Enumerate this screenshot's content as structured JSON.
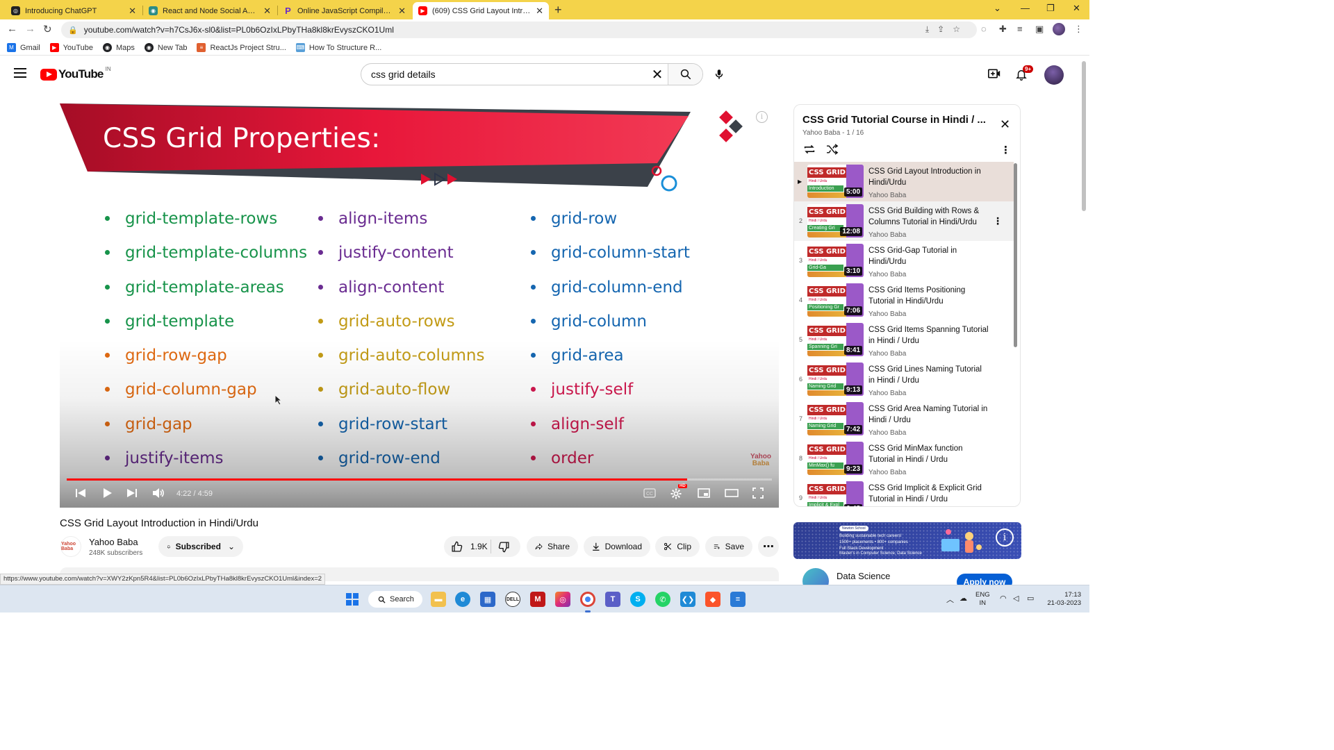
{
  "browser": {
    "tabs": [
      {
        "title": "Introducing ChatGPT",
        "color": "#222"
      },
      {
        "title": "React and Node Social App with ",
        "color": "#2a8c85"
      },
      {
        "title": "Online JavaScript Compiler (Edit",
        "color": "#6a2cc7"
      },
      {
        "title": "(609) CSS Grid Layout Introductio",
        "color": "#ff0000"
      }
    ],
    "url": "youtube.com/watch?v=h7CsJ6x-sl0&list=PL0b6OzIxLPbyTHa8kl8krEvyszCKO1Uml",
    "bookmarks": [
      {
        "label": "Gmail",
        "color": "#1a73e8",
        "glyph": "M"
      },
      {
        "label": "YouTube",
        "color": "#ff0000",
        "glyph": "▶"
      },
      {
        "label": "Maps",
        "color": "#202124",
        "glyph": "◉"
      },
      {
        "label": "New Tab",
        "color": "#202124",
        "glyph": "◉"
      },
      {
        "label": "ReactJs Project Stru...",
        "color": "#e06030",
        "glyph": "≡"
      },
      {
        "label": "How To Structure R...",
        "color": "#5aa0d8",
        "glyph": "⌨"
      }
    ]
  },
  "youtube": {
    "logo_word": "YouTube",
    "country": "IN",
    "search_value": "css grid details",
    "notif_badge": "9+"
  },
  "player": {
    "slide_title": "CSS Grid Properties:",
    "columns": [
      [
        {
          "text": "grid-template-rows",
          "color": "#17934a"
        },
        {
          "text": "grid-template-columns",
          "color": "#17934a"
        },
        {
          "text": "grid-template-areas",
          "color": "#17934a"
        },
        {
          "text": "grid-template",
          "color": "#17934a"
        },
        {
          "text": "grid-row-gap",
          "color": "#e06a12"
        },
        {
          "text": "grid-column-gap",
          "color": "#e06a12"
        },
        {
          "text": "grid-gap",
          "color": "#e06a12"
        },
        {
          "text": "justify-items",
          "color": "#6a2c91"
        }
      ],
      [
        {
          "text": "align-items",
          "color": "#6a2c91"
        },
        {
          "text": "justify-content",
          "color": "#6a2c91"
        },
        {
          "text": "align-content",
          "color": "#6a2c91"
        },
        {
          "text": "grid-auto-rows",
          "color": "#c29b16"
        },
        {
          "text": "grid-auto-columns",
          "color": "#c29b16"
        },
        {
          "text": "grid-auto-flow",
          "color": "#c29b16"
        },
        {
          "text": "grid-row-start",
          "color": "#1566b0"
        },
        {
          "text": "grid-row-end",
          "color": "#1566b0"
        }
      ],
      [
        {
          "text": "grid-row",
          "color": "#1566b0"
        },
        {
          "text": "grid-column-start",
          "color": "#1566b0"
        },
        {
          "text": "grid-column-end",
          "color": "#1566b0"
        },
        {
          "text": "grid-column",
          "color": "#1566b0"
        },
        {
          "text": "grid-area",
          "color": "#1566b0"
        },
        {
          "text": "justify-self",
          "color": "#d2184f"
        },
        {
          "text": "align-self",
          "color": "#d2184f"
        },
        {
          "text": "order",
          "color": "#d2184f"
        }
      ]
    ],
    "watermark_top": "Yahoo",
    "watermark_bottom": "Baba",
    "time": "4:22 / 4:59",
    "progress": 0.88
  },
  "video": {
    "title": "CSS Grid Layout Introduction in Hindi/Urdu",
    "channel_name": "Yahoo Baba",
    "channel_avatar_text": "Yahoo Baba",
    "subscribers": "248K subscribers",
    "subscribe_label": "Subscribed",
    "likes": "1.9K",
    "share_label": "Share",
    "download_label": "Download",
    "clip_label": "Clip",
    "save_label": "Save"
  },
  "playlist": {
    "title": "CSS Grid Tutorial Course in Hindi / ...",
    "subtitle": "Yahoo Baba - 1 / 16",
    "items": [
      {
        "index": "▶",
        "title": "CSS Grid Layout Introduction in Hindi/Urdu",
        "channel": "Yahoo Baba",
        "duration": "5:00",
        "thumb_tag": "Introduction"
      },
      {
        "index": "2",
        "title": "CSS Grid Building with Rows & Columns Tutorial in Hindi/Urdu",
        "channel": "Yahoo Baba",
        "duration": "12:08",
        "thumb_tag": "Creating Gri"
      },
      {
        "index": "3",
        "title": "CSS Grid-Gap Tutorial in Hindi/Urdu",
        "channel": "Yahoo Baba",
        "duration": "3:10",
        "thumb_tag": "Grid-Ga"
      },
      {
        "index": "4",
        "title": "CSS Grid Items Positioning Tutorial in Hindi/Urdu",
        "channel": "Yahoo Baba",
        "duration": "7:06",
        "thumb_tag": "Positioning Gr"
      },
      {
        "index": "5",
        "title": "CSS Grid Items Spanning Tutorial in Hindi / Urdu",
        "channel": "Yahoo Baba",
        "duration": "8:41",
        "thumb_tag": "Spanning Gri"
      },
      {
        "index": "6",
        "title": "CSS Grid Lines Naming Tutorial in Hindi / Urdu",
        "channel": "Yahoo Baba",
        "duration": "9:13",
        "thumb_tag": "Naming Grid"
      },
      {
        "index": "7",
        "title": "CSS Grid Area Naming Tutorial in Hindi / Urdu",
        "channel": "Yahoo Baba",
        "duration": "7:42",
        "thumb_tag": "Naming Grid"
      },
      {
        "index": "8",
        "title": "CSS Grid MinMax function Tutorial in Hindi / Urdu",
        "channel": "Yahoo Baba",
        "duration": "9:23",
        "thumb_tag": "MinMax() fu"
      },
      {
        "index": "9",
        "title": "CSS Grid Implicit & Explicit Grid Tutorial in Hindi / Urdu",
        "channel": "",
        "duration": "6:48",
        "thumb_tag": "Implicit & Expl"
      }
    ],
    "thumb_brand": "CSS GRID",
    "thumb_lang": "Hindi / Urdu"
  },
  "ad": {
    "banner_logo": "Newton School",
    "line1": "Building sustainable tech careers!",
    "line2": "1500+ placements • 800+ companies",
    "line3": "Full Stack Development",
    "line4": "Master's in Computer Science, Data Science",
    "advertiser": "Data Science",
    "cta": "Apply now"
  },
  "status_url": "https://www.youtube.com/watch?v=XWY2zKpn5R4&list=PL0b6OzIxLPbyTHa8kl8krEvyszCKO1Uml&index=2",
  "taskbar": {
    "search_label": "Search",
    "lang_top": "ENG",
    "lang_bottom": "IN",
    "time": "17:13",
    "date": "21-03-2023"
  }
}
